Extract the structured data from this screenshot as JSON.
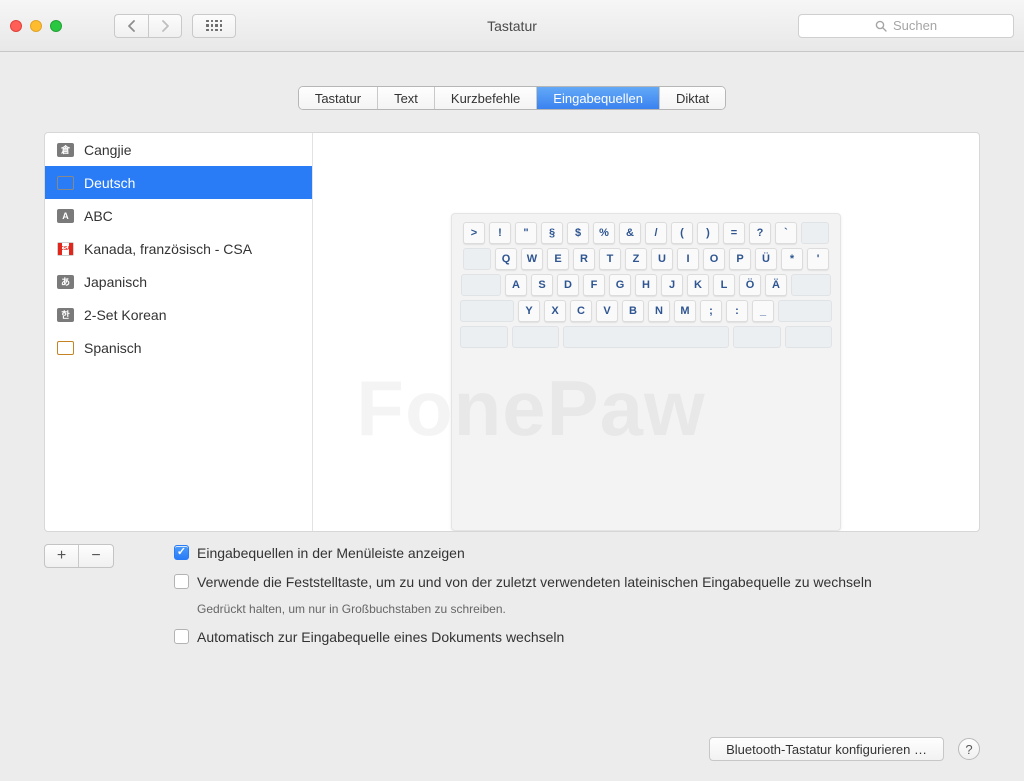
{
  "window": {
    "title": "Tastatur"
  },
  "search": {
    "placeholder": "Suchen"
  },
  "tabs": [
    {
      "label": "Tastatur"
    },
    {
      "label": "Text"
    },
    {
      "label": "Kurzbefehle"
    },
    {
      "label": "Eingabequellen"
    },
    {
      "label": "Diktat"
    }
  ],
  "sources": [
    {
      "label": "Cangjie"
    },
    {
      "label": "Deutsch"
    },
    {
      "label": "ABC"
    },
    {
      "label": "Kanada, französisch - CSA"
    },
    {
      "label": "Japanisch"
    },
    {
      "label": "2-Set Korean"
    },
    {
      "label": "Spanisch"
    }
  ],
  "keyboard": {
    "r1": [
      ">",
      "!",
      "\"",
      "§",
      "$",
      "%",
      "&",
      "/",
      "(",
      ")",
      "=",
      "?",
      "`"
    ],
    "r2": [
      "Q",
      "W",
      "E",
      "R",
      "T",
      "Z",
      "U",
      "I",
      "O",
      "P",
      "Ü",
      "*",
      "'"
    ],
    "r3": [
      "A",
      "S",
      "D",
      "F",
      "G",
      "H",
      "J",
      "K",
      "L",
      "Ö",
      "Ä"
    ],
    "r4": [
      "Y",
      "X",
      "C",
      "V",
      "B",
      "N",
      "M",
      ";",
      ":",
      "_"
    ]
  },
  "watermark": "FonePaw",
  "checks": {
    "c1": "Eingabequellen in der Menüleiste anzeigen",
    "c2": "Verwende die Feststelltaste, um zu und von der zuletzt verwendeten lateinischen Eingabequelle zu wechseln",
    "hint2": "Gedrückt halten, um nur in Großbuchstaben zu schreiben.",
    "c3": "Automatisch zur Eingabequelle eines Dokuments wechseln"
  },
  "footer": {
    "bluetooth": "Bluetooth-Tastatur konfigurieren …"
  },
  "icons": {
    "source_cangjie": "倉",
    "source_abc": "A",
    "source_jp": "あ",
    "source_kr": "한",
    "source_ca": "CSA"
  }
}
